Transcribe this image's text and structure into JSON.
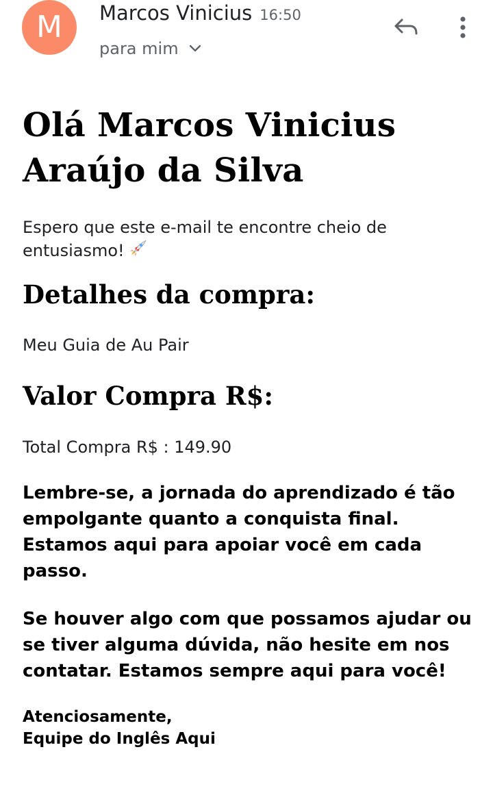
{
  "header": {
    "avatar_letter": "M",
    "avatar_color": "#fb8a68",
    "sender_name": "Marcos Vinicius",
    "time": "16:50",
    "recipient_label": "para mim",
    "icons": [
      "chevron-down-icon",
      "reply-icon",
      "more-vert-icon"
    ]
  },
  "email": {
    "greeting": "Olá Marcos Vinicius Araújo da Silva",
    "intro": "Espero que este e-mail te encontre cheio de entusiasmo!",
    "intro_emoji": "rocket-icon",
    "details_heading": "Detalhes da compra:",
    "product": "Meu Guia de Au Pair",
    "value_heading": "Valor Compra R$:",
    "total": "Total Compra R$ : 149.90",
    "remember": "Lembre-se, a jornada do aprendizado é tão empolgante quanto a conquista final. Estamos aqui para apoiar você em cada passo.",
    "help": "Se houver algo com que possamos ajudar ou se tiver alguma dúvida, não hesite em nos contatar. Estamos sempre aqui para você!",
    "signoff": "Atenciosamente,",
    "team": "Equipe do Inglês Aqui"
  }
}
